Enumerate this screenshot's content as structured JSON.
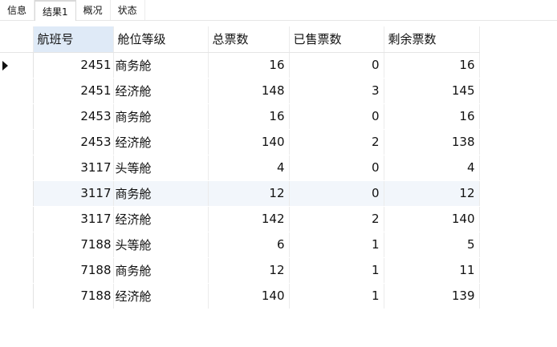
{
  "tabs": [
    {
      "label": "信息",
      "active": false
    },
    {
      "label": "结果1",
      "active": true
    },
    {
      "label": "概况",
      "active": false
    },
    {
      "label": "状态",
      "active": false
    }
  ],
  "table": {
    "headers": [
      "航班号",
      "舱位等级",
      "总票数",
      "已售票数",
      "剩余票数"
    ],
    "rows": [
      [
        "2451",
        "商务舱",
        "16",
        "0",
        "16"
      ],
      [
        "2451",
        "经济舱",
        "148",
        "3",
        "145"
      ],
      [
        "2453",
        "商务舱",
        "16",
        "0",
        "16"
      ],
      [
        "2453",
        "经济舱",
        "140",
        "2",
        "138"
      ],
      [
        "3117",
        "头等舱",
        "4",
        "0",
        "4"
      ],
      [
        "3117",
        "商务舱",
        "12",
        "0",
        "12"
      ],
      [
        "3117",
        "经济舱",
        "142",
        "2",
        "140"
      ],
      [
        "7188",
        "头等舱",
        "6",
        "1",
        "5"
      ],
      [
        "7188",
        "商务舱",
        "12",
        "1",
        "11"
      ],
      [
        "7188",
        "经济舱",
        "140",
        "1",
        "139"
      ]
    ]
  }
}
